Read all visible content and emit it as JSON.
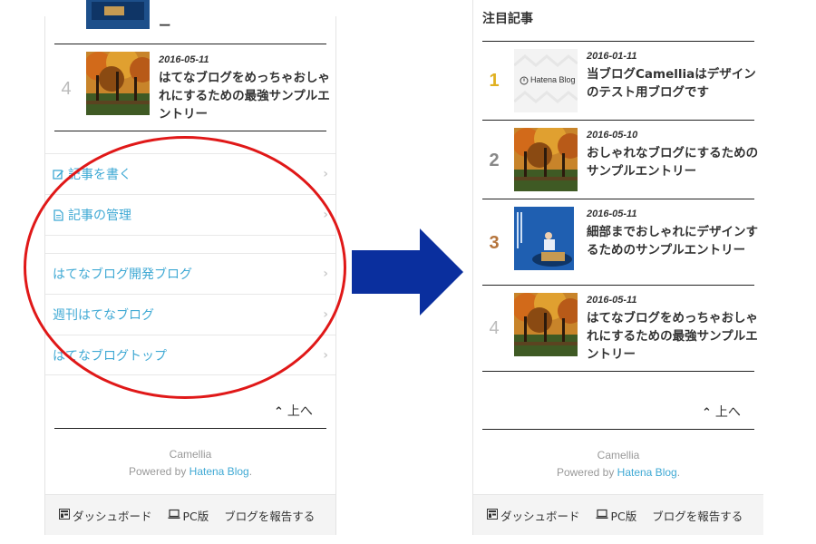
{
  "left": {
    "top_entry_tail": "ー",
    "entry4": {
      "rank": "4",
      "date": "2016-05-11",
      "title": "はてなブログをめっちゃおしゃれにするための最強サンプルエントリー"
    },
    "menu": {
      "write_entry": "記事を書く",
      "manage_entries": "記事の管理",
      "dev_blog": "はてなブログ開発ブログ",
      "weekly_hatena": "週刊はてなブログ",
      "hatena_top": "はてなブログトップ"
    },
    "up_label": "上へ",
    "footer": {
      "theme": "Camellia",
      "powered_prefix": "Powered by ",
      "powered_link": "Hatena Blog",
      "powered_suffix": "."
    },
    "bottom_bar": {
      "dashboard": "ダッシュボード",
      "pc": "PC版",
      "report": "ブログを報告する"
    }
  },
  "right": {
    "section_heading": "注目記事",
    "thumb1_logo": "Hatena Blog",
    "entries": [
      {
        "rank": "1",
        "date": "2016-01-11",
        "title": "当ブログCamelliaはデザインのテスト用ブログです"
      },
      {
        "rank": "2",
        "date": "2016-05-10",
        "title": "おしゃれなブログにするためのサンプルエントリー"
      },
      {
        "rank": "3",
        "date": "2016-05-11",
        "title": "細部までおしゃれにデザインするためのサンプルエントリー"
      },
      {
        "rank": "4",
        "date": "2016-05-11",
        "title": "はてなブログをめっちゃおしゃれにするための最強サンプルエントリー"
      }
    ],
    "up_label": "上へ",
    "footer": {
      "theme": "Camellia",
      "powered_prefix": "Powered by ",
      "powered_link": "Hatena Blog",
      "powered_suffix": "."
    },
    "bottom_bar": {
      "dashboard": "ダッシュボード",
      "pc": "PC版",
      "report": "ブログを報告する"
    }
  },
  "colors": {
    "link": "#3fa9d4",
    "annotation_red": "#e01818",
    "arrow_blue": "#0a2f9e",
    "rank_gold": "#e0b020",
    "rank_bronze": "#b5743c"
  }
}
